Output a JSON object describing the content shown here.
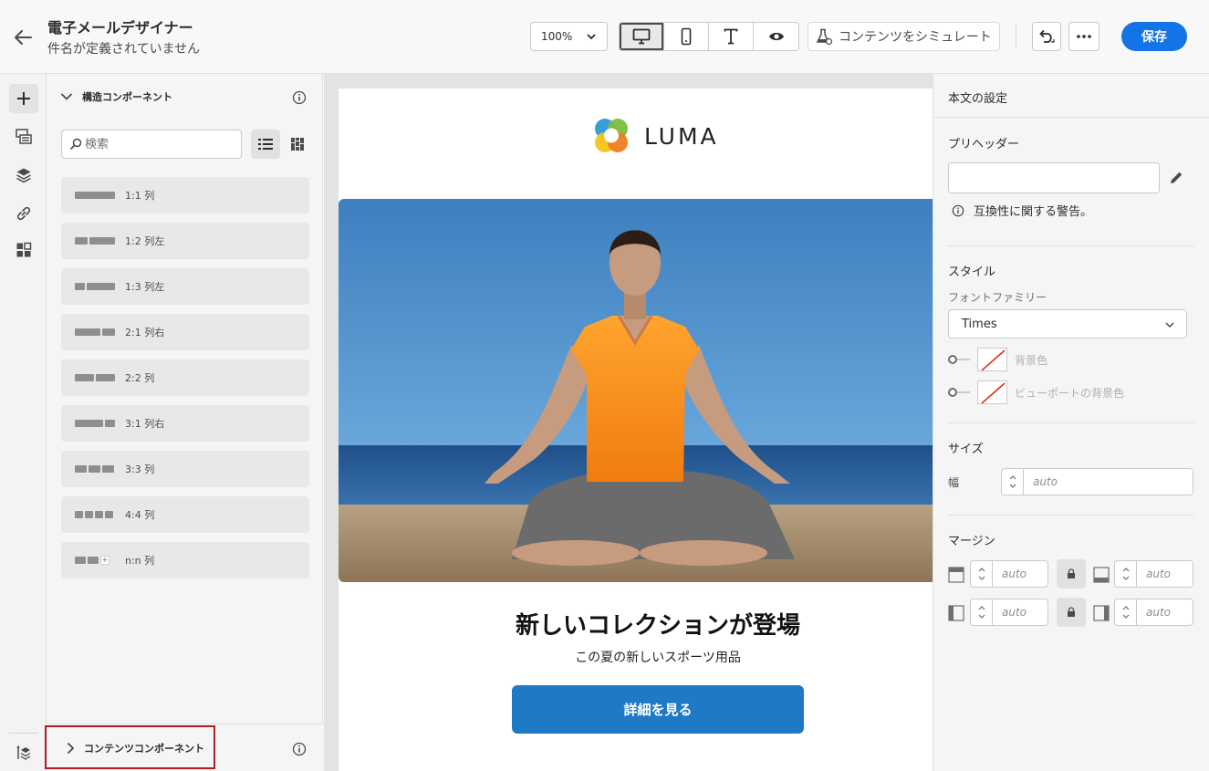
{
  "header": {
    "title": "電子メールデザイナー",
    "subtitle": "件名が定義されていません",
    "zoom": "100%",
    "simulate_label": "コンテンツをシミュレート",
    "save_label": "保存"
  },
  "components_panel": {
    "structure_header": "構造コンポーネント",
    "search_placeholder": "検索",
    "items": [
      {
        "label": "1:1 列"
      },
      {
        "label": "1:2 列左"
      },
      {
        "label": "1:3 列左"
      },
      {
        "label": "2:1 列右"
      },
      {
        "label": "2:2 列"
      },
      {
        "label": "3:1 列右"
      },
      {
        "label": "3:3 列"
      },
      {
        "label": "4:4 列"
      },
      {
        "label": "n:n 列"
      }
    ],
    "content_header": "コンテンツコンポーネント"
  },
  "email": {
    "logo_text": "LUMA",
    "headline": "新しいコレクションが登場",
    "tagline": "この夏の新しいスポーツ用品",
    "cta_label": "詳細を見る"
  },
  "settings": {
    "title": "本文の設定",
    "preheader_label": "プリヘッダー",
    "preheader_value": "",
    "warning": "互換性に関する警告。",
    "style_label": "スタイル",
    "font_family_label": "フォントファミリー",
    "font_family_value": "Times",
    "bg_color_label": "背景色",
    "viewport_bg_label": "ビューポートの背景色",
    "size_label": "サイズ",
    "width_label": "幅",
    "width_placeholder": "auto",
    "margin_label": "マージン",
    "margin_placeholder": "auto"
  },
  "colors": {
    "accent": "#1473e6",
    "cta": "#1e7ac6",
    "highlight": "#b31d1d"
  }
}
